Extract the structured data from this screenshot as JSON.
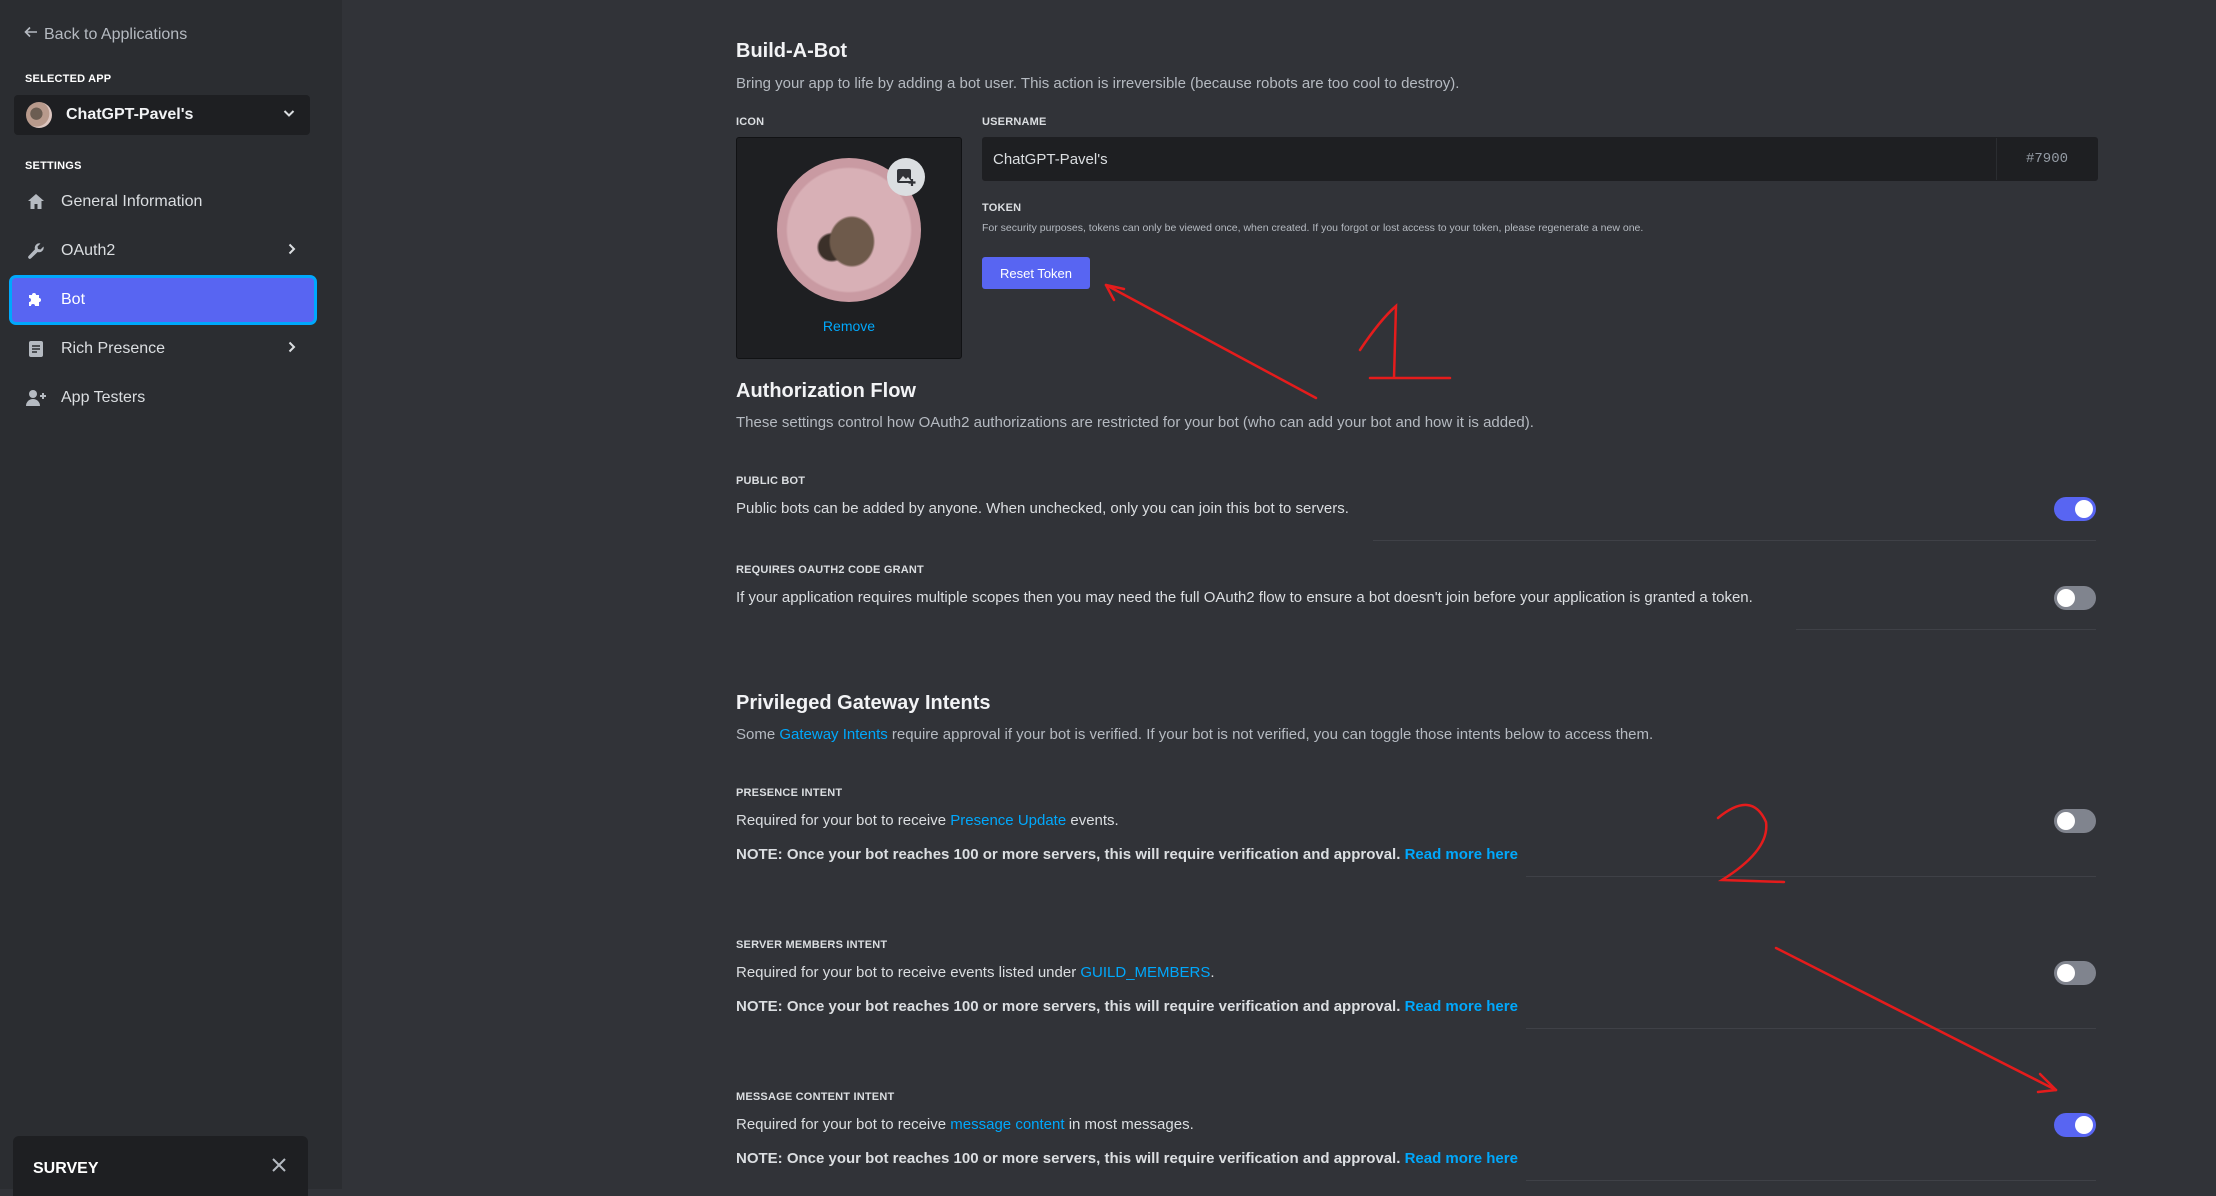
{
  "sidebar": {
    "back_label": "Back to Applications",
    "selected_app_label": "SELECTED APP",
    "app_name": "ChatGPT-Pavel's",
    "settings_label": "SETTINGS",
    "items": [
      {
        "label": "General Information",
        "icon": "home-icon"
      },
      {
        "label": "OAuth2",
        "icon": "wrench-icon"
      },
      {
        "label": "Bot",
        "icon": "puzzle-icon"
      },
      {
        "label": "Rich Presence",
        "icon": "document-icon"
      },
      {
        "label": "App Testers",
        "icon": "user-add-icon"
      }
    ],
    "survey_label": "SURVEY"
  },
  "build_bot": {
    "title": "Build-A-Bot",
    "description": "Bring your app to life by adding a bot user. This action is irreversible (because robots are too cool to destroy).",
    "icon_label": "ICON",
    "remove_label": "Remove",
    "username_label": "USERNAME",
    "username_value": "ChatGPT-Pavel's",
    "discriminator": "#7900",
    "token_label": "TOKEN",
    "token_note": "For security purposes, tokens can only be viewed once, when created. If you forgot or lost access to your token, please regenerate a new one.",
    "reset_token_label": "Reset Token"
  },
  "auth_flow": {
    "title": "Authorization Flow",
    "description": "These settings control how OAuth2 authorizations are restricted for your bot (who can add your bot and how it is added).",
    "public_bot_label": "PUBLIC BOT",
    "public_bot_desc": "Public bots can be added by anyone. When unchecked, only you can join this bot to servers.",
    "public_bot_enabled": true,
    "code_grant_label": "REQUIRES OAUTH2 CODE GRANT",
    "code_grant_desc": "If your application requires multiple scopes then you may need the full OAuth2 flow to ensure a bot doesn't join before your application is granted a token.",
    "code_grant_enabled": false
  },
  "intents": {
    "title": "Privileged Gateway Intents",
    "desc_pre": "Some ",
    "desc_link": "Gateway Intents",
    "desc_post": " require approval if your bot is verified. If your bot is not verified, you can toggle those intents below to access them.",
    "note_text": "NOTE: Once your bot reaches 100 or more servers, this will require verification and approval. ",
    "read_more": "Read more here",
    "presence": {
      "label": "PRESENCE INTENT",
      "pre": "Required for your bot to receive ",
      "link": "Presence Update",
      "post": " events.",
      "enabled": false
    },
    "members": {
      "label": "SERVER MEMBERS INTENT",
      "pre": "Required for your bot to receive events listed under ",
      "link": "GUILD_MEMBERS",
      "post": ".",
      "enabled": false
    },
    "message": {
      "label": "MESSAGE CONTENT INTENT",
      "pre": "Required for your bot to receive ",
      "link": "message content",
      "post": " in most messages.",
      "enabled": true
    }
  },
  "colors": {
    "accent": "#5865f2",
    "link": "#00a8fc",
    "annotation": "#e51c1c"
  }
}
